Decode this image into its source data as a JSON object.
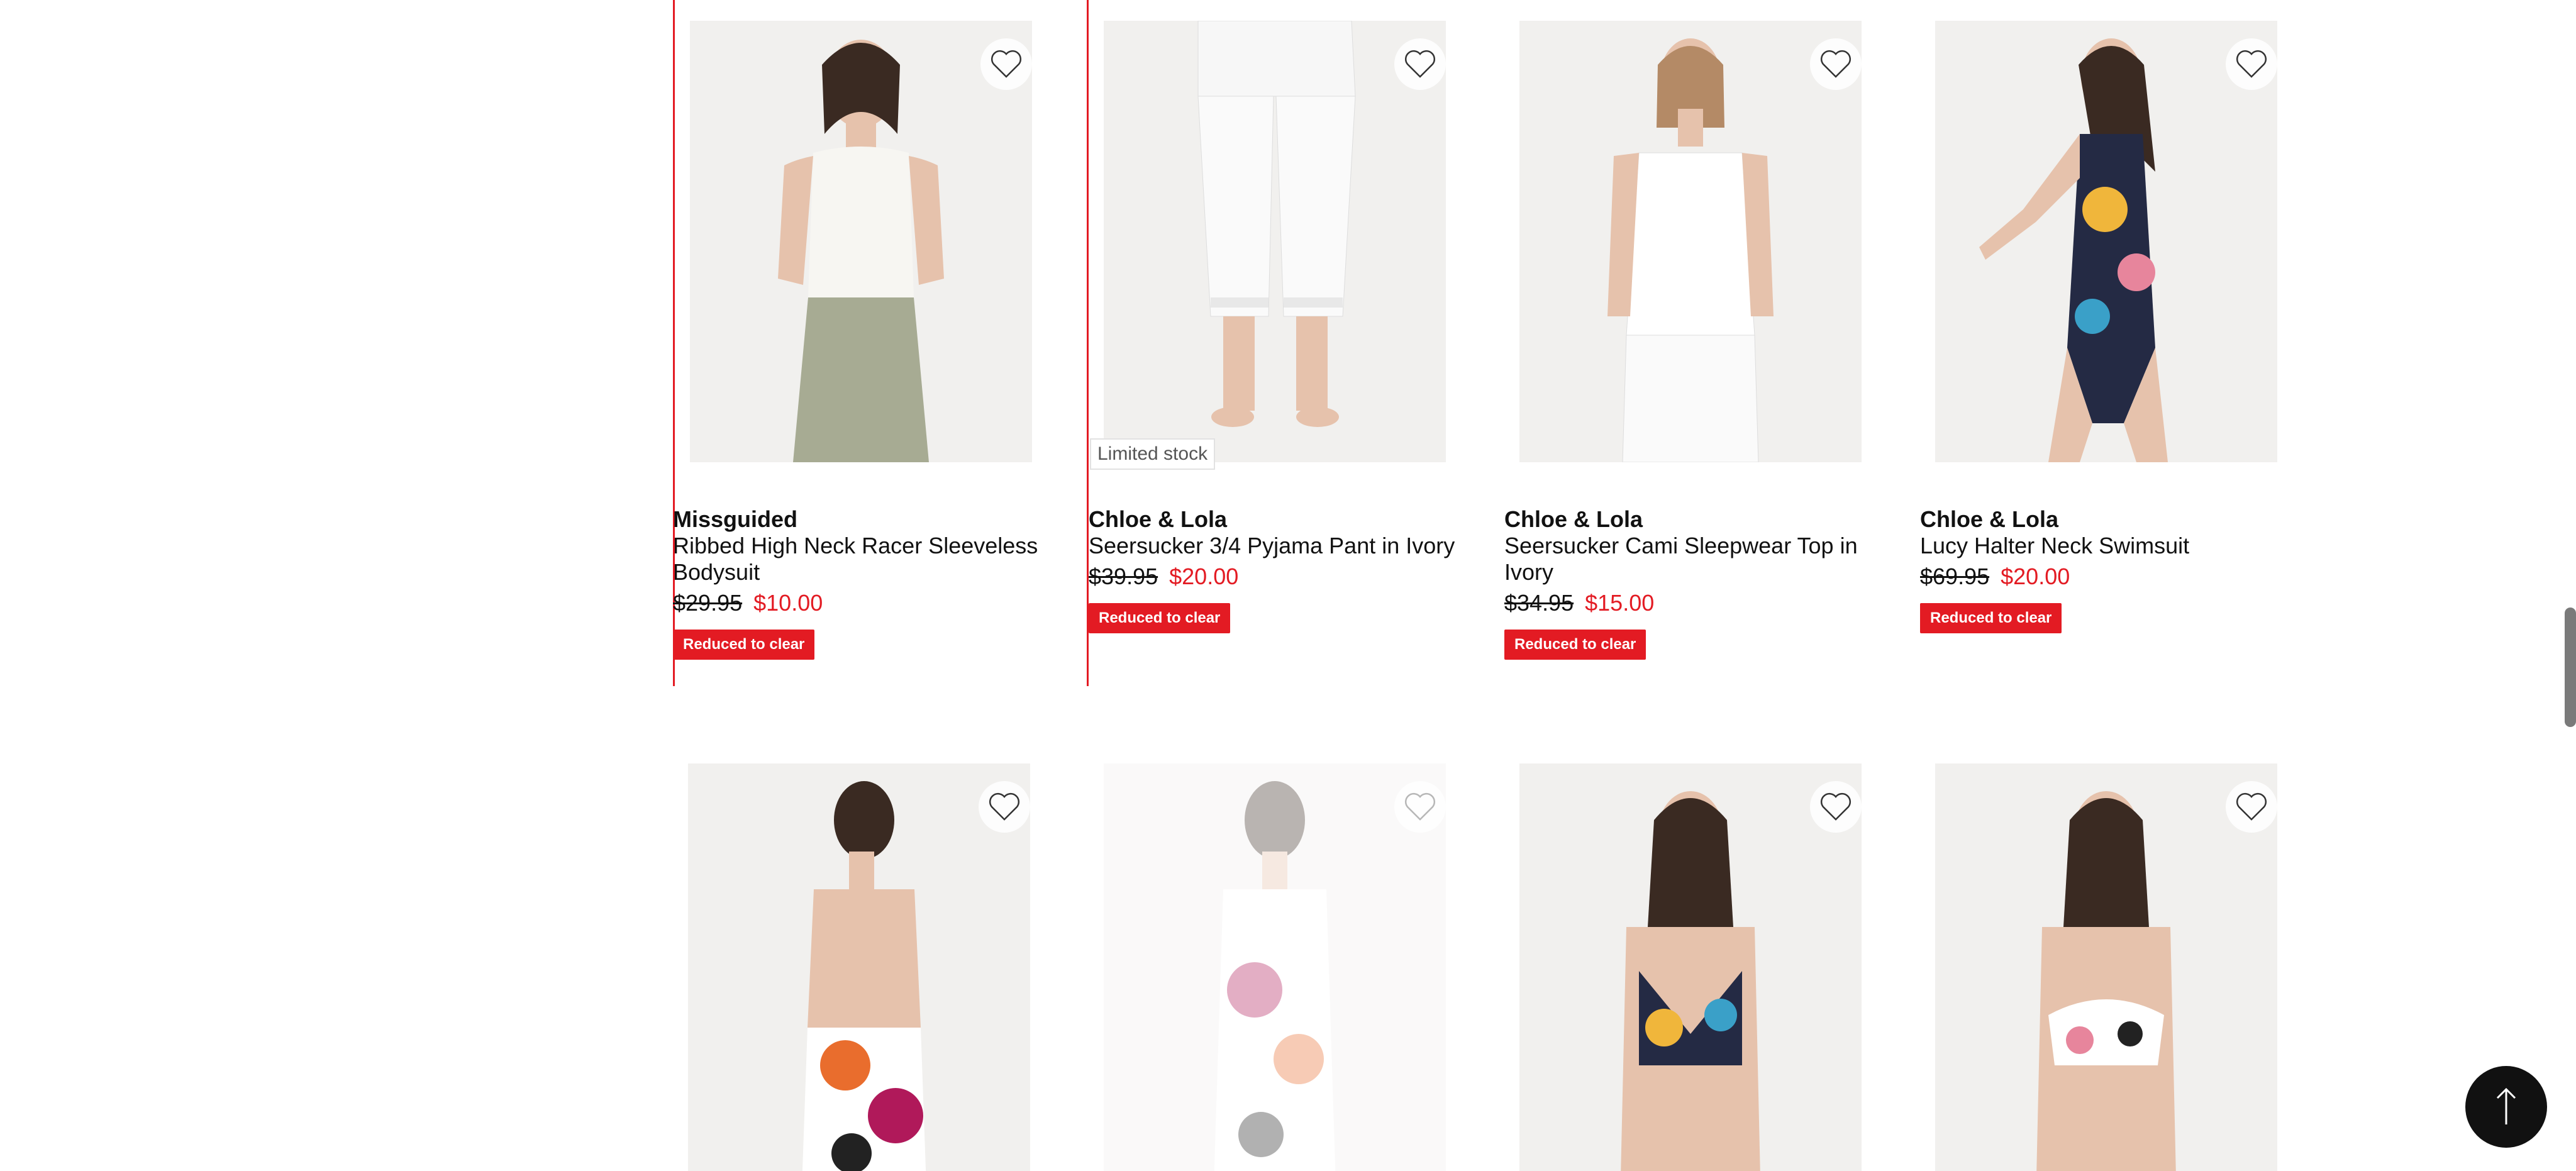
{
  "products_row1": [
    {
      "brand": "Missguided",
      "name": "Ribbed High Neck Racer Sleeveless Bodysuit",
      "was_price": "$29.95",
      "now_price": "$10.00",
      "badge": "Reduced to clear",
      "image": "white-bodysuit-green-skirt"
    },
    {
      "brand": "Chloe & Lola",
      "name": "Seersucker 3/4 Pyjama Pant in Ivory",
      "was_price": "$39.95",
      "now_price": "$20.00",
      "badge": "Reduced to clear",
      "stock_label": "Limited stock",
      "image": "white-pyjama-pant"
    },
    {
      "brand": "Chloe & Lola",
      "name": "Seersucker Cami Sleepwear Top in Ivory",
      "was_price": "$34.95",
      "now_price": "$15.00",
      "badge": "Reduced to clear",
      "image": "white-cami-top"
    },
    {
      "brand": "Chloe & Lola",
      "name": "Lucy Halter Neck Swimsuit",
      "was_price": "$69.95",
      "now_price": "$20.00",
      "badge": "Reduced to clear",
      "image": "navy-print-halter-swimsuit"
    }
  ],
  "products_row2": [
    {
      "image": "floral-swimsuit-back"
    },
    {
      "image": "floral-swimsuit-front"
    },
    {
      "image": "navy-print-bikini-top"
    },
    {
      "image": "white-print-bikini-top"
    }
  ],
  "icons": {
    "favorite": "heart-outline-icon",
    "back_to_top": "arrow-up-icon"
  },
  "colors": {
    "accent": "#e31b23",
    "text": "#111111",
    "button": "#111111"
  }
}
